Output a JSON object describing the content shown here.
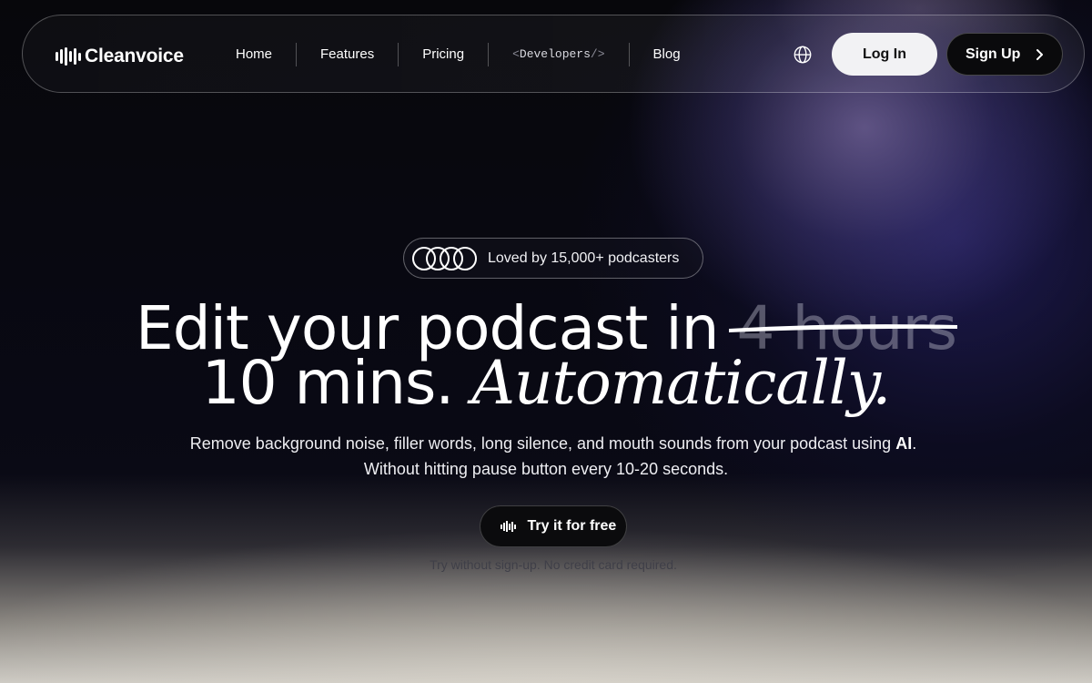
{
  "nav": {
    "logo_text": "Cleanvoice",
    "menu": {
      "home": "Home",
      "features": "Features",
      "pricing": "Pricing",
      "developers_open": "<",
      "developers": "Developers",
      "developers_close": "/>",
      "blog": "Blog"
    },
    "globe_icon": "globe-icon",
    "login_label": "Log In",
    "signup_label": "Sign Up",
    "signup_icon": "chevron-right-icon"
  },
  "hero": {
    "badge_text": "Loved by 15,000+ podcasters",
    "badge_icon": "four-rings-icon",
    "headline_part1": "Edit your podcast in ",
    "headline_struck": "4 hours",
    "headline_part2": "10 mins. ",
    "headline_italic": "Automatically.",
    "subtext_line1_before": "Remove background noise, filler words, long silence, and mouth sounds from your podcast using ",
    "subtext_line1_bold": "AI",
    "subtext_line1_after": ".",
    "subtext_line2": "Without hitting pause button every 10-20 seconds.",
    "cta_label": "Try it for free",
    "cta_icon": "waveform-icon",
    "note": "Try without sign-up. No credit card required."
  },
  "colors": {
    "accent_purple": "#6a5fa0",
    "button_light": "#f2f2f4",
    "button_dark": "#0a0a0c"
  }
}
